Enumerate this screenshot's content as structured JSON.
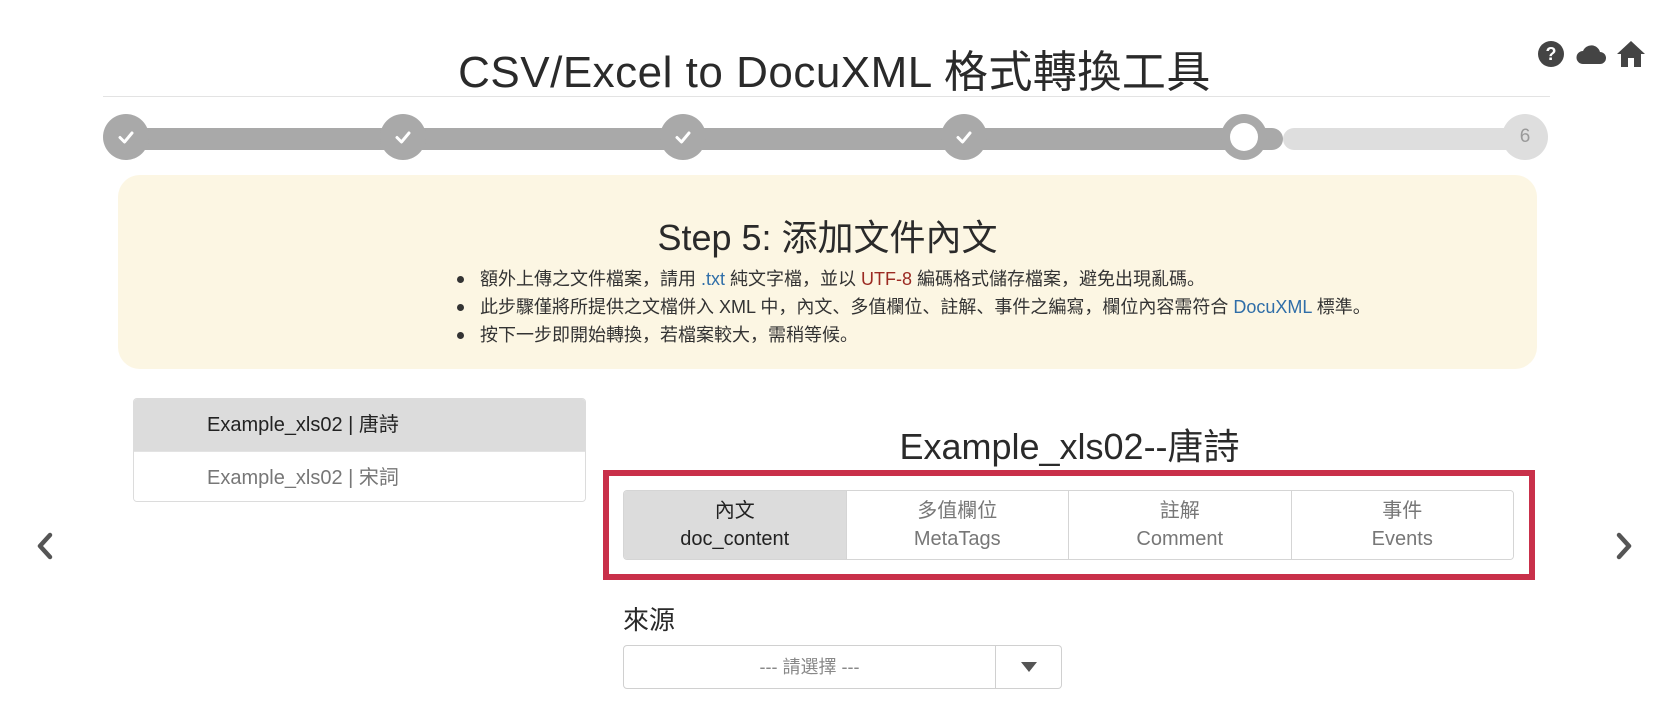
{
  "app": {
    "title": "CSV/Excel to DocuXML 格式轉換工具"
  },
  "top_icons": [
    {
      "name": "help-icon"
    },
    {
      "name": "cloud-icon"
    },
    {
      "name": "home-icon"
    }
  ],
  "stepper": {
    "current_step": 5,
    "total_steps": 6,
    "steps": [
      {
        "state": "done",
        "label": ""
      },
      {
        "state": "done",
        "label": ""
      },
      {
        "state": "done",
        "label": ""
      },
      {
        "state": "done",
        "label": ""
      },
      {
        "state": "current",
        "label": ""
      },
      {
        "state": "pending",
        "label": "6"
      }
    ]
  },
  "info": {
    "heading": "Step 5: 添加文件內文",
    "bullets": {
      "b1_pre": "額外上傳之文件檔案，請用 ",
      "b1_txt": ".txt",
      "b1_mid": " 純文字檔，並以 ",
      "b1_utf": "UTF-8",
      "b1_post": " 編碼格式儲存檔案，避免出現亂碼。",
      "b2_pre": "此步驟僅將所提供之文檔併入 XML 中，內文、多值欄位、註解、事件之編寫，欄位內容需符合 ",
      "b2_link": "DocuXML",
      "b2_post": " 標準。",
      "b3": "按下一步即開始轉換，若檔案較大，需稍等候。"
    },
    "colors": {
      "background": "#fcf6e3",
      "link": "#2f6ea8",
      "emphasis": "#9b2a22"
    }
  },
  "files": [
    {
      "label": "Example_xls02  |  唐詩",
      "active": true
    },
    {
      "label": "Example_xls02  |  宋詞",
      "active": false
    }
  ],
  "document": {
    "title": "Example_xls02--唐詩"
  },
  "tabs": [
    {
      "zh": "內文",
      "en": "doc_content",
      "active": true
    },
    {
      "zh": "多值欄位",
      "en": "MetaTags",
      "active": false
    },
    {
      "zh": "註解",
      "en": "Comment",
      "active": false
    },
    {
      "zh": "事件",
      "en": "Events",
      "active": false
    }
  ],
  "highlight_color": "#c9304a",
  "source": {
    "label": "來源",
    "selected": "--- 請選擇 ---"
  },
  "nav": {
    "prev": "chevron-left-icon",
    "next": "chevron-right-icon"
  }
}
